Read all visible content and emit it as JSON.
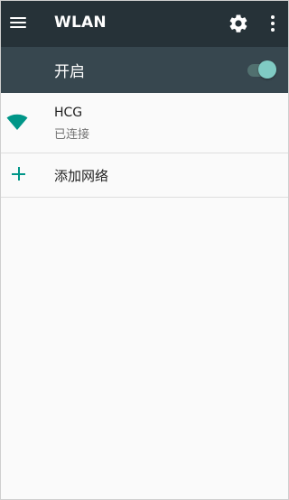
{
  "appbar": {
    "title": "WLAN",
    "menu_icon": "hamburger-menu-icon",
    "settings_icon": "gear-icon",
    "overflow_icon": "more-vert-icon",
    "background": "#263238"
  },
  "switch": {
    "label": "开启",
    "state": "on",
    "accent": "#80cbc4",
    "background": "#37474f"
  },
  "networks": [
    {
      "name": "HCG",
      "status": "已连接",
      "icon": "wifi-signal-icon"
    }
  ],
  "add_network": {
    "label": "添加网络",
    "icon": "plus-icon",
    "accent": "#009688"
  }
}
